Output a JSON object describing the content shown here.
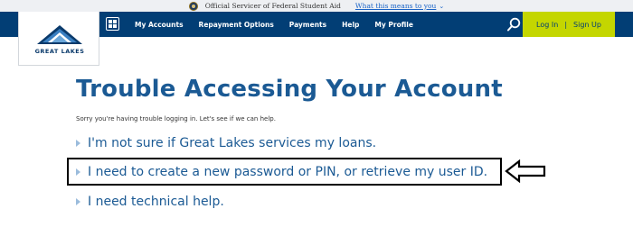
{
  "banner": {
    "official_text": "Official Servicer of Federal Student Aid",
    "what_link": "What this means to you",
    "seal_icon": "federal-student-aid-seal"
  },
  "logo": {
    "text": "GREAT LAKES"
  },
  "nav": {
    "menu_icon": "grid-menu-icon",
    "items": [
      {
        "label": "My Accounts"
      },
      {
        "label": "Repayment Options"
      },
      {
        "label": "Payments"
      },
      {
        "label": "Help"
      },
      {
        "label": "My Profile"
      }
    ],
    "search_icon": "search-icon",
    "login_label": "Log In",
    "separator": "|",
    "signup_label": "Sign Up"
  },
  "main": {
    "title": "Trouble Accessing Your Account",
    "subtitle": "Sorry you're having trouble logging in. Let's see if we can help.",
    "options": [
      {
        "label": "I'm not sure if Great Lakes services my loans."
      },
      {
        "label": "I need to create a new password or PIN, or retrieve my user ID."
      },
      {
        "label": "I need technical help."
      }
    ]
  },
  "annotation": {
    "arrow_icon": "left-arrow-outline-icon"
  },
  "colors": {
    "nav_bg": "#023e75",
    "auth_bg": "#c4d600",
    "title": "#1b5a94",
    "link": "#1a63c6"
  }
}
